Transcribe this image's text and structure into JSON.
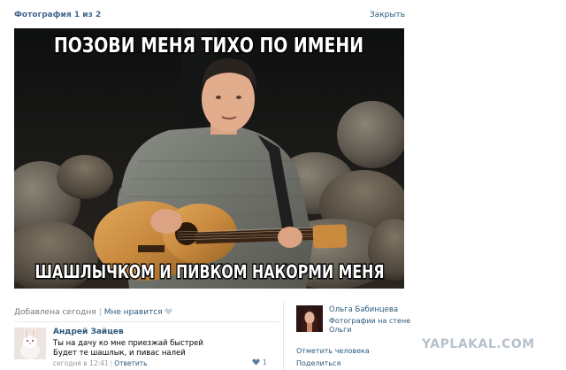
{
  "header": {
    "counter": "Фотография 1 из 2",
    "close_label": "Закрыть"
  },
  "photo": {
    "caption_top": "ПОЗОВИ МЕНЯ ТИХО ПО ИМЕНИ",
    "caption_bottom": "ШАШЛЫЧКОМ И ПИВКОМ НАКОРМИ МЕНЯ"
  },
  "meta": {
    "added": "Добавлена сегодня",
    "separator": "|",
    "like_label": "Мне нравится",
    "like_icon": "heart-icon"
  },
  "comment": {
    "author": "Андрей Зайцев",
    "lines": [
      "Ты на дачу ко мне приезжай быстрей",
      "Будет те шашлык, и пивас налей"
    ],
    "time": "сегодня в 12:41",
    "separator": "|",
    "reply_label": "Ответить",
    "likes_count": "1",
    "likes_icon": "heart-icon"
  },
  "sidebar": {
    "owner_name": "Ольга Бабинцева",
    "album_line1": "Фотографии на стене",
    "album_line2": "Ольги",
    "mark_person": "Отметить человека",
    "share": "Поделиться"
  },
  "watermark": "YAPLAKAL.COM",
  "colors": {
    "link": "#2b587a",
    "header_link": "#45688e",
    "muted": "#777777",
    "divider": "#e7e8ec",
    "watermark": "#b8c2cc"
  }
}
